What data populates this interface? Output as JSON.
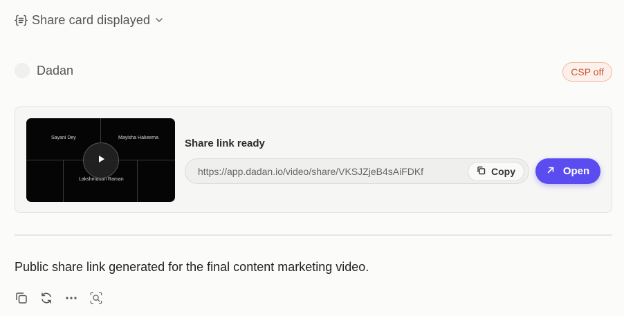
{
  "tool_call": {
    "title": "Share card displayed"
  },
  "user": {
    "name": "Dadan"
  },
  "badge": {
    "label": "CSP off"
  },
  "share_card": {
    "thumbnail": {
      "participants": [
        "Sayani Dey",
        "Mayisha Hakeema",
        "Lakshmanan Raman"
      ]
    },
    "label": "Share link ready",
    "url": "https://app.dadan.io/video/share/VKSJZjeB4sAiFDKf",
    "copy_label": "Copy",
    "open_label": "Open"
  },
  "message": {
    "text": "Public share link generated for the final content marketing video."
  },
  "colors": {
    "accent": "#5b4cf0",
    "badge_text": "#c45a32",
    "badge_border": "#f0b9a2",
    "badge_bg": "#fdf0ea"
  },
  "icons": {
    "tool": "braces-list-icon",
    "chevron": "chevron-down-icon",
    "play": "play-icon",
    "copy": "copy-icon",
    "open": "arrow-up-right-icon",
    "actions": [
      "copy-icon",
      "refresh-icon",
      "more-icon",
      "inspect-icon"
    ]
  }
}
